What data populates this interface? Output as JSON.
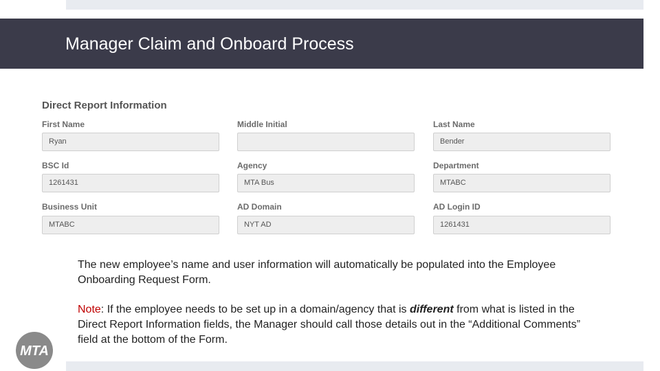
{
  "slide": {
    "title": "Manager Claim and Onboard Process"
  },
  "form": {
    "heading": "Direct Report Information",
    "fields": [
      {
        "label": "First Name",
        "value": ""
      },
      {
        "label": "Middle Initial",
        "value": ""
      },
      {
        "label": "Last Name",
        "value": "Bender"
      },
      {
        "label": "BSC Id",
        "value": "1261431"
      },
      {
        "label": "Agency",
        "value": "MTA Bus"
      },
      {
        "label": "Department",
        "value": "MTABC"
      },
      {
        "label": "Business Unit",
        "value": "MTABC"
      },
      {
        "label": "AD Domain",
        "value": "NYT AD"
      },
      {
        "label": "AD Login ID",
        "value": "1261431"
      }
    ]
  },
  "body": {
    "paragraph1": "The new employee’s name and user information will automatically be populated into the Employee Onboarding Request Form.",
    "note_label": "Note",
    "note_part1": ": If the employee needs to be set up in a domain/agency that is ",
    "note_emphasis": "different",
    "note_part2": " from what is listed in the Direct Report Information fields, the Manager should call those details out in the “Additional Comments” field at the bottom of the Form."
  },
  "logo": {
    "text": "MTA",
    "icon": "mta-logo-icon"
  },
  "colors": {
    "title_bar": "#3b3b4a",
    "note_label": "#c00000",
    "input_background": "#eeeeee"
  }
}
